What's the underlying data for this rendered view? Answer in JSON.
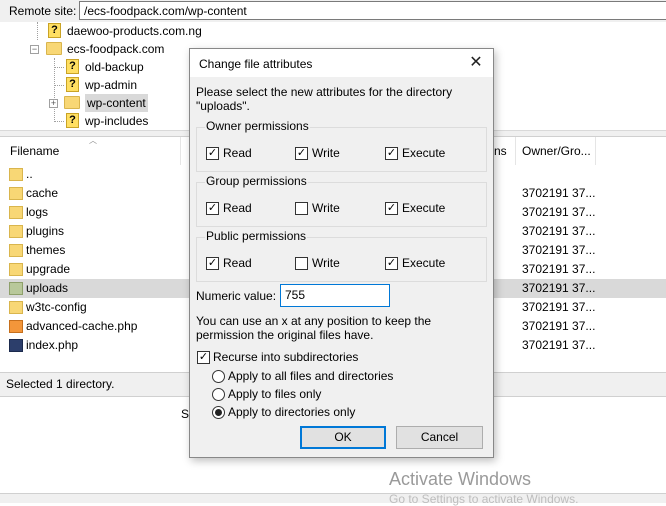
{
  "remote": {
    "label": "Remote site:",
    "path": "/ecs-foodpack.com/wp-content"
  },
  "tree": [
    {
      "label": "daewoo-products.com.ng",
      "icon": "question-folder-icon"
    },
    {
      "label": "ecs-foodpack.com",
      "icon": "folder-icon"
    },
    {
      "label": "old-backup",
      "icon": "question-folder-icon"
    },
    {
      "label": "wp-admin",
      "icon": "question-folder-icon"
    },
    {
      "label": "wp-content",
      "icon": "folder-icon"
    },
    {
      "label": "wp-includes",
      "icon": "question-folder-icon"
    }
  ],
  "filelist": {
    "columns": {
      "filename": "Filename",
      "permissions": "ns",
      "owner": "Owner/Gro..."
    },
    "rows": [
      {
        "name": "..",
        "owner": "",
        "icon": "folder-icon"
      },
      {
        "name": "cache",
        "owner": "3702191 37...",
        "icon": "folder-icon"
      },
      {
        "name": "logs",
        "owner": "3702191 37...",
        "icon": "folder-icon"
      },
      {
        "name": "plugins",
        "owner": "3702191 37...",
        "icon": "folder-icon"
      },
      {
        "name": "themes",
        "owner": "3702191 37...",
        "icon": "folder-icon"
      },
      {
        "name": "upgrade",
        "owner": "3702191 37...",
        "icon": "folder-icon"
      },
      {
        "name": "uploads",
        "owner": "3702191 37...",
        "icon": "folder-icon",
        "selected": true
      },
      {
        "name": "w3tc-config",
        "owner": "3702191 37...",
        "icon": "folder-icon"
      },
      {
        "name": "advanced-cache.php",
        "owner": "3702191 37...",
        "icon": "sublime-file-icon"
      },
      {
        "name": "index.php",
        "owner": "3702191 37...",
        "icon": "sublime-file-icon"
      }
    ]
  },
  "status": {
    "text": "Selected 1 directory."
  },
  "queue": {
    "fragment": "Si"
  },
  "watermark": {
    "title": "Activate Windows",
    "subtitle": "Go to Settings to activate Windows."
  },
  "dialog": {
    "title": "Change file attributes",
    "close": "✕",
    "intro": "Please select the new attributes for the directory \"uploads\".",
    "groups": [
      {
        "title": "Owner permissions",
        "read": true,
        "write": true,
        "execute": true
      },
      {
        "title": "Group permissions",
        "read": true,
        "write": false,
        "execute": true
      },
      {
        "title": "Public permissions",
        "read": true,
        "write": false,
        "execute": true
      }
    ],
    "labels": {
      "read": "Read",
      "write": "Write",
      "execute": "Execute"
    },
    "numeric_label": "Numeric value:",
    "numeric_value": "755",
    "hint": "You can use an x at any position to keep the permission the original files have.",
    "recurse_label": "Recurse into subdirectories",
    "recurse_checked": true,
    "apply_options": [
      {
        "label": "Apply to all files and directories",
        "selected": false
      },
      {
        "label": "Apply to files only",
        "selected": false
      },
      {
        "label": "Apply to directories only",
        "selected": true
      }
    ],
    "ok": "OK",
    "cancel": "Cancel"
  }
}
